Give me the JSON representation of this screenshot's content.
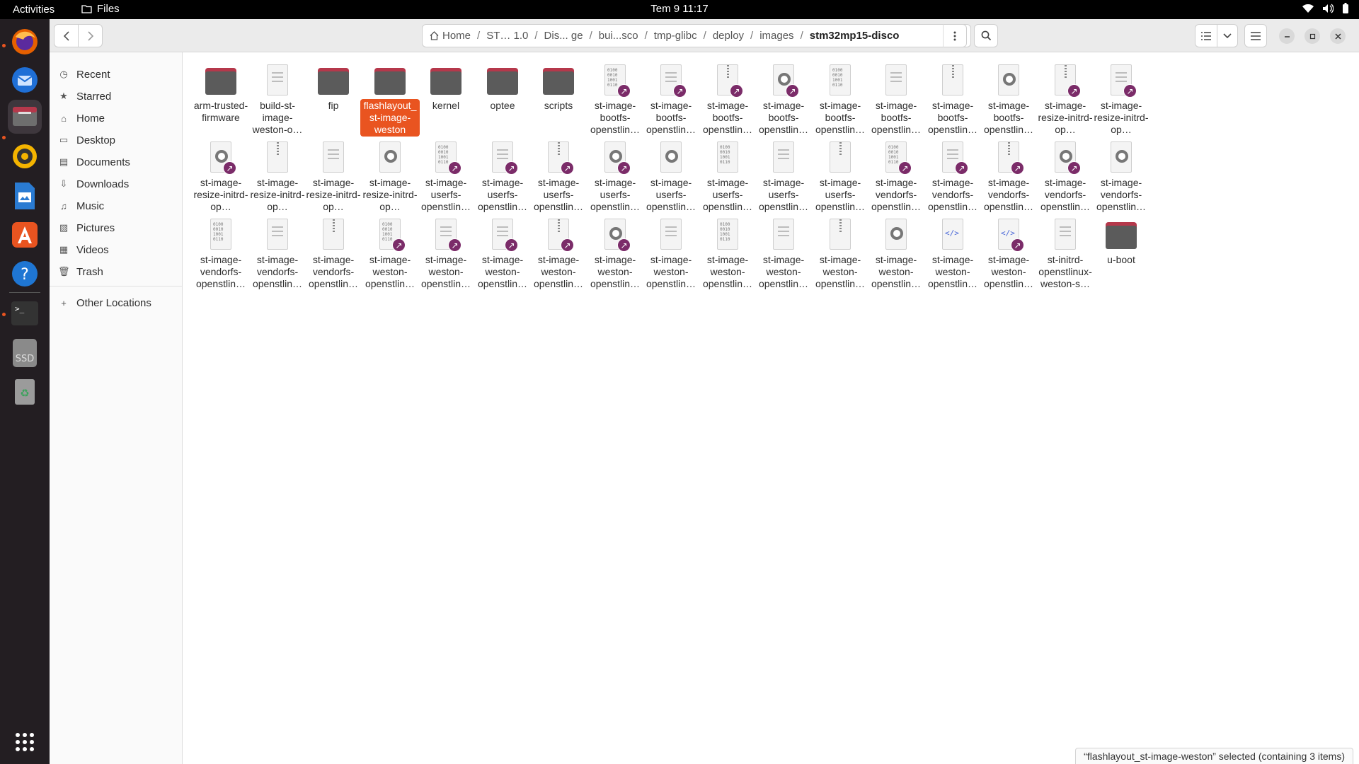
{
  "topbar": {
    "activities": "Activities",
    "app_name": "Files",
    "clock": "Tem 9  11:17"
  },
  "headerbar": {
    "path": [
      {
        "label": "Home",
        "icon": "home-icon"
      },
      {
        "label": "ST…  1.0"
      },
      {
        "label": "Dis... ge"
      },
      {
        "label": "bui...sco"
      },
      {
        "label": "tmp-glibc"
      },
      {
        "label": "deploy"
      },
      {
        "label": "images"
      },
      {
        "label": "stm32mp15-disco",
        "current": true
      }
    ],
    "path_separator": "/"
  },
  "sidebar": {
    "items": [
      {
        "label": "Recent",
        "icon": "clock-icon"
      },
      {
        "label": "Starred",
        "icon": "star-icon"
      },
      {
        "label": "Home",
        "icon": "home-icon"
      },
      {
        "label": "Desktop",
        "icon": "desktop-icon"
      },
      {
        "label": "Documents",
        "icon": "document-icon"
      },
      {
        "label": "Downloads",
        "icon": "download-icon"
      },
      {
        "label": "Music",
        "icon": "music-icon"
      },
      {
        "label": "Pictures",
        "icon": "picture-icon"
      },
      {
        "label": "Videos",
        "icon": "video-icon"
      },
      {
        "label": "Trash",
        "icon": "trash-icon"
      }
    ],
    "other_locations": "Other Locations"
  },
  "files": [
    {
      "label": "arm-trusted-firmware",
      "type": "folder"
    },
    {
      "label": "build-st-image-weston-o…",
      "type": "text"
    },
    {
      "label": "fip",
      "type": "folder"
    },
    {
      "label": "flashlayout_st-image-weston",
      "type": "folder",
      "selected": true
    },
    {
      "label": "kernel",
      "type": "folder"
    },
    {
      "label": "optee",
      "type": "folder"
    },
    {
      "label": "scripts",
      "type": "folder"
    },
    {
      "label": "st-image-bootfs-openstlin…",
      "type": "binary",
      "link": true
    },
    {
      "label": "st-image-bootfs-openstlin…",
      "type": "text",
      "link": true
    },
    {
      "label": "st-image-bootfs-openstlin…",
      "type": "archive",
      "link": true
    },
    {
      "label": "st-image-bootfs-openstlin…",
      "type": "disc",
      "link": true
    },
    {
      "label": "st-image-bootfs-openstlin…",
      "type": "binary"
    },
    {
      "label": "st-image-bootfs-openstlin…",
      "type": "text"
    },
    {
      "label": "st-image-bootfs-openstlin…",
      "type": "archive"
    },
    {
      "label": "st-image-bootfs-openstlin…",
      "type": "disc"
    },
    {
      "label": "st-image-resize-initrd-op…",
      "type": "archive",
      "link": true
    },
    {
      "label": "st-image-resize-initrd-op…",
      "type": "text",
      "link": true
    },
    {
      "label": "st-image-resize-initrd-op…",
      "type": "disc",
      "link": true
    },
    {
      "label": "st-image-resize-initrd-op…",
      "type": "archive"
    },
    {
      "label": "st-image-resize-initrd-op…",
      "type": "text"
    },
    {
      "label": "st-image-resize-initrd-op…",
      "type": "disc"
    },
    {
      "label": "st-image-userfs-openstlin…",
      "type": "binary",
      "link": true
    },
    {
      "label": "st-image-userfs-openstlin…",
      "type": "text",
      "link": true
    },
    {
      "label": "st-image-userfs-openstlin…",
      "type": "archive",
      "link": true
    },
    {
      "label": "st-image-userfs-openstlin…",
      "type": "disc",
      "link": true
    },
    {
      "label": "st-image-userfs-openstlin…",
      "type": "disc"
    },
    {
      "label": "st-image-userfs-openstlin…",
      "type": "binary"
    },
    {
      "label": "st-image-userfs-openstlin…",
      "type": "text"
    },
    {
      "label": "st-image-userfs-openstlin…",
      "type": "archive"
    },
    {
      "label": "st-image-vendorfs-openstlin…",
      "type": "binary",
      "link": true
    },
    {
      "label": "st-image-vendorfs-openstlin…",
      "type": "text",
      "link": true
    },
    {
      "label": "st-image-vendorfs-openstlin…",
      "type": "archive",
      "link": true
    },
    {
      "label": "st-image-vendorfs-openstlin…",
      "type": "disc",
      "link": true
    },
    {
      "label": "st-image-vendorfs-openstlin…",
      "type": "disc"
    },
    {
      "label": "st-image-vendorfs-openstlin…",
      "type": "binary"
    },
    {
      "label": "st-image-vendorfs-openstlin…",
      "type": "text"
    },
    {
      "label": "st-image-vendorfs-openstlin…",
      "type": "archive"
    },
    {
      "label": "st-image-weston-openstlin…",
      "type": "binary",
      "link": true
    },
    {
      "label": "st-image-weston-openstlin…",
      "type": "text",
      "link": true
    },
    {
      "label": "st-image-weston-openstlin…",
      "type": "text",
      "link": true
    },
    {
      "label": "st-image-weston-openstlin…",
      "type": "archive",
      "link": true
    },
    {
      "label": "st-image-weston-openstlin…",
      "type": "disc",
      "link": true
    },
    {
      "label": "st-image-weston-openstlin…",
      "type": "text"
    },
    {
      "label": "st-image-weston-openstlin…",
      "type": "binary"
    },
    {
      "label": "st-image-weston-openstlin…",
      "type": "text"
    },
    {
      "label": "st-image-weston-openstlin…",
      "type": "archive"
    },
    {
      "label": "st-image-weston-openstlin…",
      "type": "disc"
    },
    {
      "label": "st-image-weston-openstlin…",
      "type": "code"
    },
    {
      "label": "st-image-weston-openstlin…",
      "type": "code",
      "link": true
    },
    {
      "label": "st-initrd-openstlinux-weston-s…",
      "type": "text"
    },
    {
      "label": "u-boot",
      "type": "folder"
    }
  ],
  "status": "“flashlayout_st-image-weston” selected  (containing 3 items)",
  "colors": {
    "accent": "#e95420",
    "folder_tab": "#b5384b",
    "folder_body": "#5b5b5b",
    "link_badge": "#7b2c69",
    "dock": "#231e22"
  }
}
